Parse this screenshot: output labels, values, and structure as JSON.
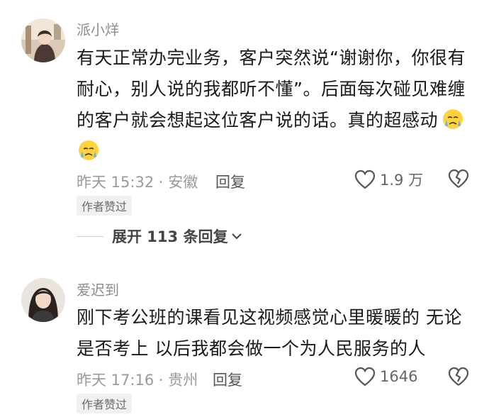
{
  "comments": [
    {
      "username": "派小烊",
      "content": "有天正常办完业务，客户突然说“谢谢你，你很有耐心，别人说的我都听不懂”。后面每次碰见难缠的客户就会想起这位客户说的话。真的超感动",
      "time_location": "昨天 15:32 · 安徽",
      "reply_label": "回复",
      "like_count": "1.9 万",
      "badge": "作者赞过"
    },
    {
      "username": "爱迟到",
      "content": "刚下考公班的课看见这视频感觉心里暖暖的 无论是否考上 以后我都会做一个为人民服务的人",
      "time_location": "昨天 17:16 · 贵州",
      "reply_label": "回复",
      "like_count": "1646",
      "badge": "作者赞过"
    }
  ],
  "expand_replies": "展开 113 条回复",
  "colors": {
    "text": "#1a1a1a",
    "meta": "#9a9a9a",
    "badge_bg": "#f1f1f1"
  }
}
